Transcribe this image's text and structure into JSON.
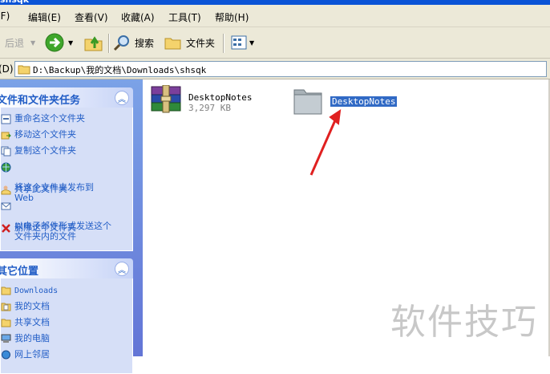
{
  "window": {
    "title": "shsqk"
  },
  "menubar": {
    "items": [
      "(F)",
      "编辑(E)",
      "查看(V)",
      "收藏(A)",
      "工具(T)",
      "帮助(H)"
    ]
  },
  "toolbar": {
    "back_label": "后退",
    "search_label": "搜索",
    "folders_label": "文件夹"
  },
  "address": {
    "label": "(D)",
    "path": "D:\\Backup\\我的文档\\Downloads\\shsqk"
  },
  "tasks_panel": {
    "title": "文件和文件夹任务",
    "items": [
      {
        "label": "重命名这个文件夹",
        "icon": "rename-icon"
      },
      {
        "label": "移动这个文件夹",
        "icon": "move-icon"
      },
      {
        "label": "复制这个文件夹",
        "icon": "copy-icon"
      },
      {
        "label": "将这个文件夹发布到\nWeb",
        "icon": "publish-web-icon"
      },
      {
        "label": "共享此文件夹",
        "icon": "share-icon"
      },
      {
        "label": "以电子邮件形式发送这个\n文件夹内的文件",
        "icon": "email-icon"
      },
      {
        "label": "删除这个文件夹",
        "icon": "delete-icon"
      }
    ]
  },
  "places_panel": {
    "title": "其它位置",
    "items": [
      {
        "label": "Downloads",
        "icon": "folder-icon"
      },
      {
        "label": "我的文档",
        "icon": "my-documents-icon"
      },
      {
        "label": "共享文档",
        "icon": "shared-documents-icon"
      },
      {
        "label": "我的电脑",
        "icon": "my-computer-icon"
      },
      {
        "label": "网上邻居",
        "icon": "network-icon"
      }
    ]
  },
  "files": [
    {
      "name": "DesktopNotes",
      "size": "3,297 KB",
      "icon": "winrar-archive-icon"
    },
    {
      "name": "DesktopNotes",
      "icon": "folder-icon",
      "selected": true
    }
  ],
  "watermark": "软件技巧",
  "colors": {
    "accent_blue": "#215dc6",
    "selection": "#316ac5",
    "annotation_arrow": "#e02020"
  }
}
